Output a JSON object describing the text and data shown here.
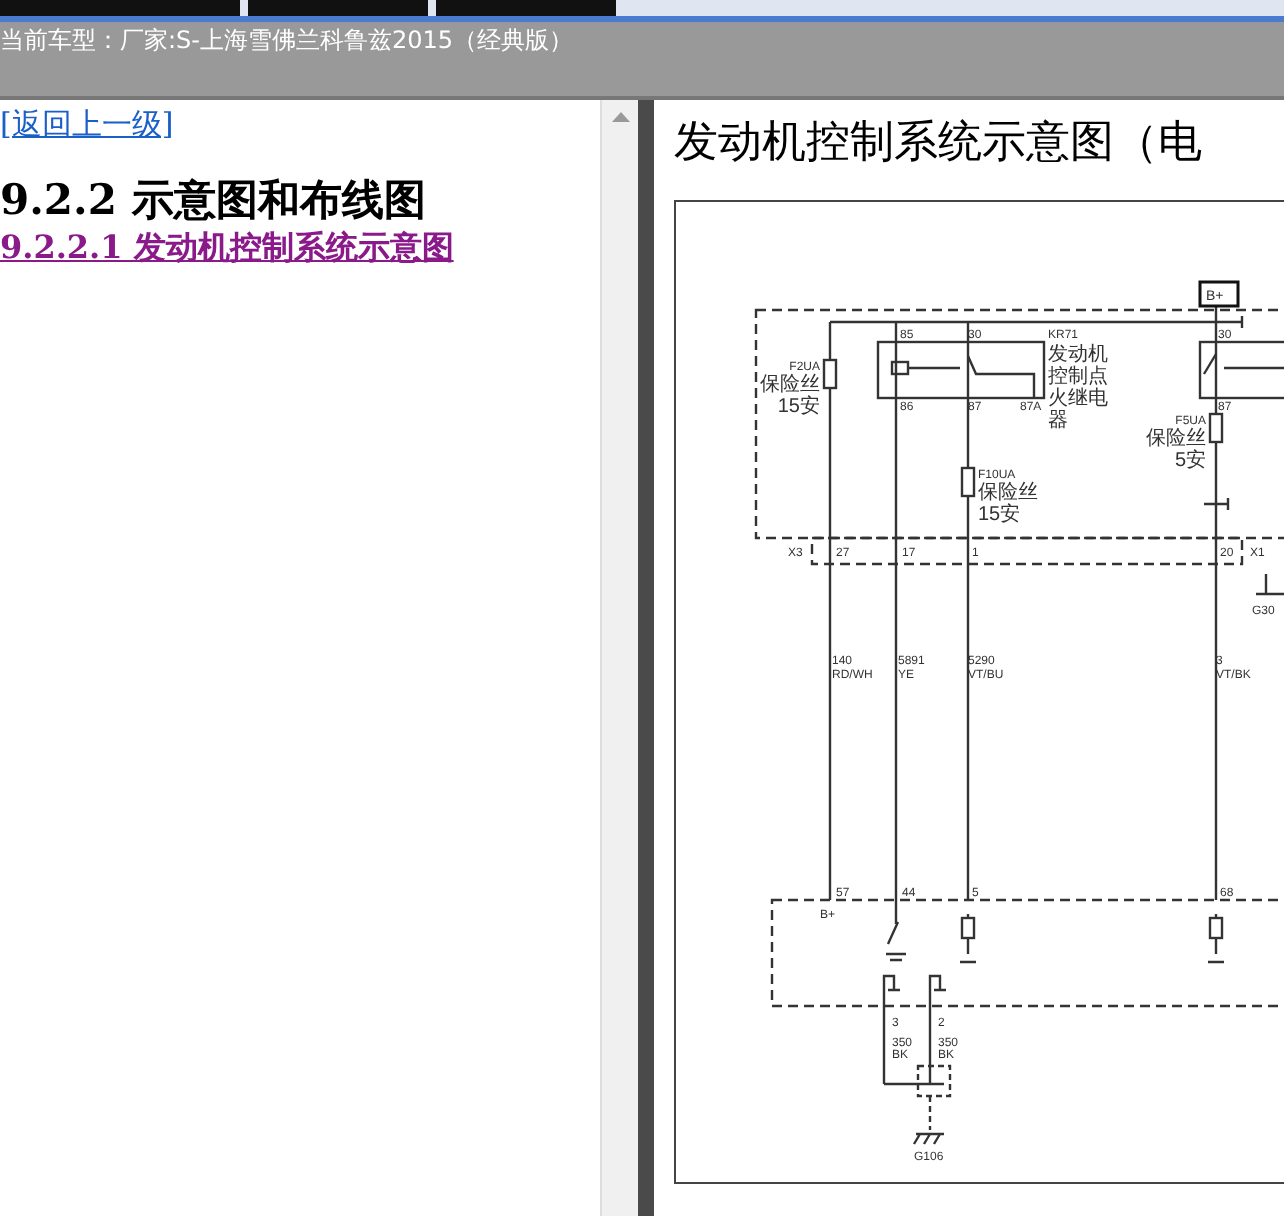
{
  "header": {
    "vehicle": "当前车型：厂家:S-上海雪佛兰科鲁兹2015（经典版）"
  },
  "left_pane": {
    "back_link": "[返回上一级]",
    "heading": "9.2.2 示意图和布线图",
    "links": [
      "9.2.2.1 发动机控制系统示意图"
    ]
  },
  "right_pane": {
    "title": "发动机控制系统示意图（电",
    "diagram": {
      "power_terminal": "B+",
      "relay": {
        "id": "KR71",
        "name_lines": [
          "发动机",
          "控制点",
          "火继电",
          "器"
        ],
        "pins": [
          "85",
          "30",
          "86",
          "87",
          "87A"
        ]
      },
      "right_relay_pins": [
        "30",
        "87"
      ],
      "fuses": [
        {
          "id": "F2UA",
          "name": "保险丝",
          "rating": "15安"
        },
        {
          "id": "F10UA",
          "name": "保险丝",
          "rating": "15安"
        },
        {
          "id": "F5UA",
          "name": "保险丝",
          "rating": "5安"
        }
      ],
      "upper_connectors": [
        "X3",
        "X1"
      ],
      "upper_pins": [
        "27",
        "17",
        "1",
        "20"
      ],
      "wires": [
        {
          "circuit": "140",
          "insulation": "RD/WH"
        },
        {
          "circuit": "5891",
          "insulation": "YE"
        },
        {
          "circuit": "5290",
          "insulation": "VT/BU"
        },
        {
          "circuit": "3",
          "insulation": "VT/BK"
        }
      ],
      "lower_pins": [
        "57",
        "44",
        "5",
        "68"
      ],
      "lower_pin_label": "B+",
      "ground_wires": [
        {
          "pin": "3",
          "circuit": "350",
          "insulation": "BK"
        },
        {
          "pin": "2",
          "circuit": "350",
          "insulation": "BK"
        }
      ],
      "grounds": [
        "G30",
        "G106"
      ]
    }
  }
}
